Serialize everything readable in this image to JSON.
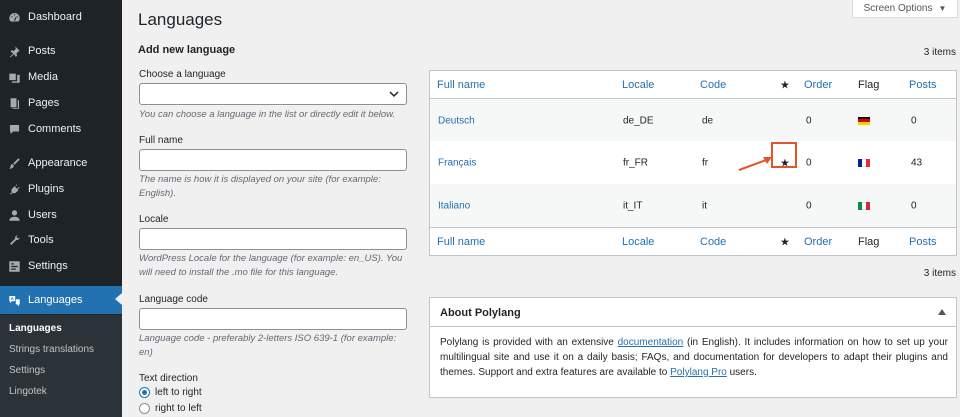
{
  "sidebar": {
    "items": [
      {
        "label": "Dashboard",
        "icon": "dashboard-icon"
      },
      {
        "label": "Posts",
        "icon": "pin-icon"
      },
      {
        "label": "Media",
        "icon": "media-icon"
      },
      {
        "label": "Pages",
        "icon": "pages-icon"
      },
      {
        "label": "Comments",
        "icon": "comment-icon"
      },
      {
        "label": "Appearance",
        "icon": "brush-icon"
      },
      {
        "label": "Plugins",
        "icon": "plug-icon"
      },
      {
        "label": "Users",
        "icon": "user-icon"
      },
      {
        "label": "Tools",
        "icon": "wrench-icon"
      },
      {
        "label": "Settings",
        "icon": "settings-icon"
      },
      {
        "label": "Languages",
        "icon": "translation-icon"
      }
    ],
    "submenu": [
      "Languages",
      "Strings translations",
      "Settings",
      "Lingotek"
    ]
  },
  "header": {
    "title": "Languages",
    "screen_options": "Screen Options"
  },
  "form": {
    "heading": "Add new language",
    "choose_label": "Choose a language",
    "choose_value": "",
    "choose_desc": "You can choose a language in the list or directly edit it below.",
    "fullname_label": "Full name",
    "fullname_value": "",
    "fullname_desc": "The name is how it is displayed on your site (for example: English).",
    "locale_label": "Locale",
    "locale_value": "",
    "locale_desc": "WordPress Locale for the language (for example: en_US). You will need to install the .mo file for this language.",
    "code_label": "Language code",
    "code_value": "",
    "code_desc": "Language code - preferably 2-letters ISO 639-1 (for example: en)",
    "direction_label": "Text direction",
    "ltr_label": "left to right",
    "rtl_label": "right to left"
  },
  "table": {
    "items_count": "3 items",
    "columns": {
      "full_name": "Full name",
      "locale": "Locale",
      "code": "Code",
      "default": "★",
      "order": "Order",
      "flag": "Flag",
      "posts": "Posts"
    },
    "rows": [
      {
        "name": "Deutsch",
        "locale": "de_DE",
        "code": "de",
        "is_default": false,
        "order": "0",
        "flag": "de",
        "posts": "0"
      },
      {
        "name": "Français",
        "locale": "fr_FR",
        "code": "fr",
        "is_default": true,
        "default_mark": "★",
        "order": "0",
        "flag": "fr",
        "posts": "43"
      },
      {
        "name": "Italiano",
        "locale": "it_IT",
        "code": "it",
        "is_default": false,
        "order": "0",
        "flag": "it",
        "posts": "0"
      }
    ]
  },
  "about": {
    "title": "About Polylang",
    "text_1": "Polylang is provided with an extensive ",
    "link_1": "documentation",
    "text_2": " (in English). It includes information on how to set up your multilingual site and use it on a daily basis; FAQs, and documentation for developers to adapt their plugins and themes. Support and extra features are available to ",
    "link_2": "Polylang Pro",
    "text_3": " users."
  },
  "colors": {
    "sidebar_bg": "#1d2327",
    "accent": "#2271b1",
    "highlight": "#e4542c"
  }
}
